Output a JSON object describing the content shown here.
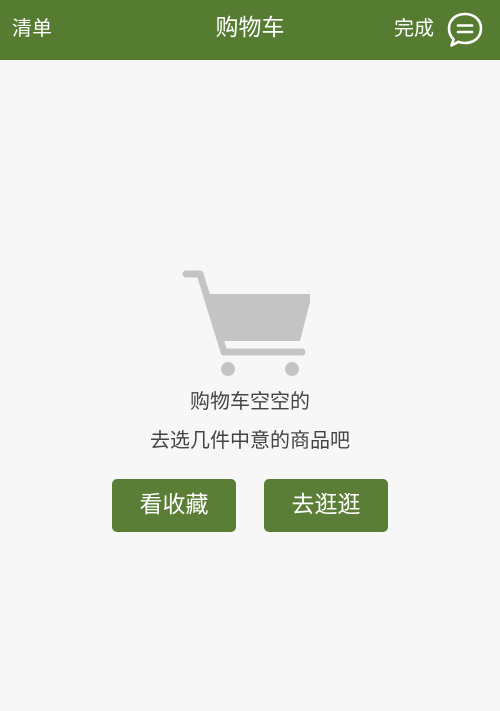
{
  "header": {
    "left_label": "清单",
    "title": "购物车",
    "right_label": "完成",
    "message_icon": "chat-bubble-icon"
  },
  "empty_state": {
    "icon": "shopping-cart-icon",
    "line1": "购物车空空的",
    "line2": "去选几件中意的商品吧"
  },
  "actions": {
    "favorites_label": "看收藏",
    "shop_label": "去逛逛"
  },
  "colors": {
    "header_bg": "#567c32",
    "button_bg": "#5a7e35",
    "background": "#f7f7f7",
    "cart_gray": "#c4c4c4",
    "text": "#444444"
  }
}
